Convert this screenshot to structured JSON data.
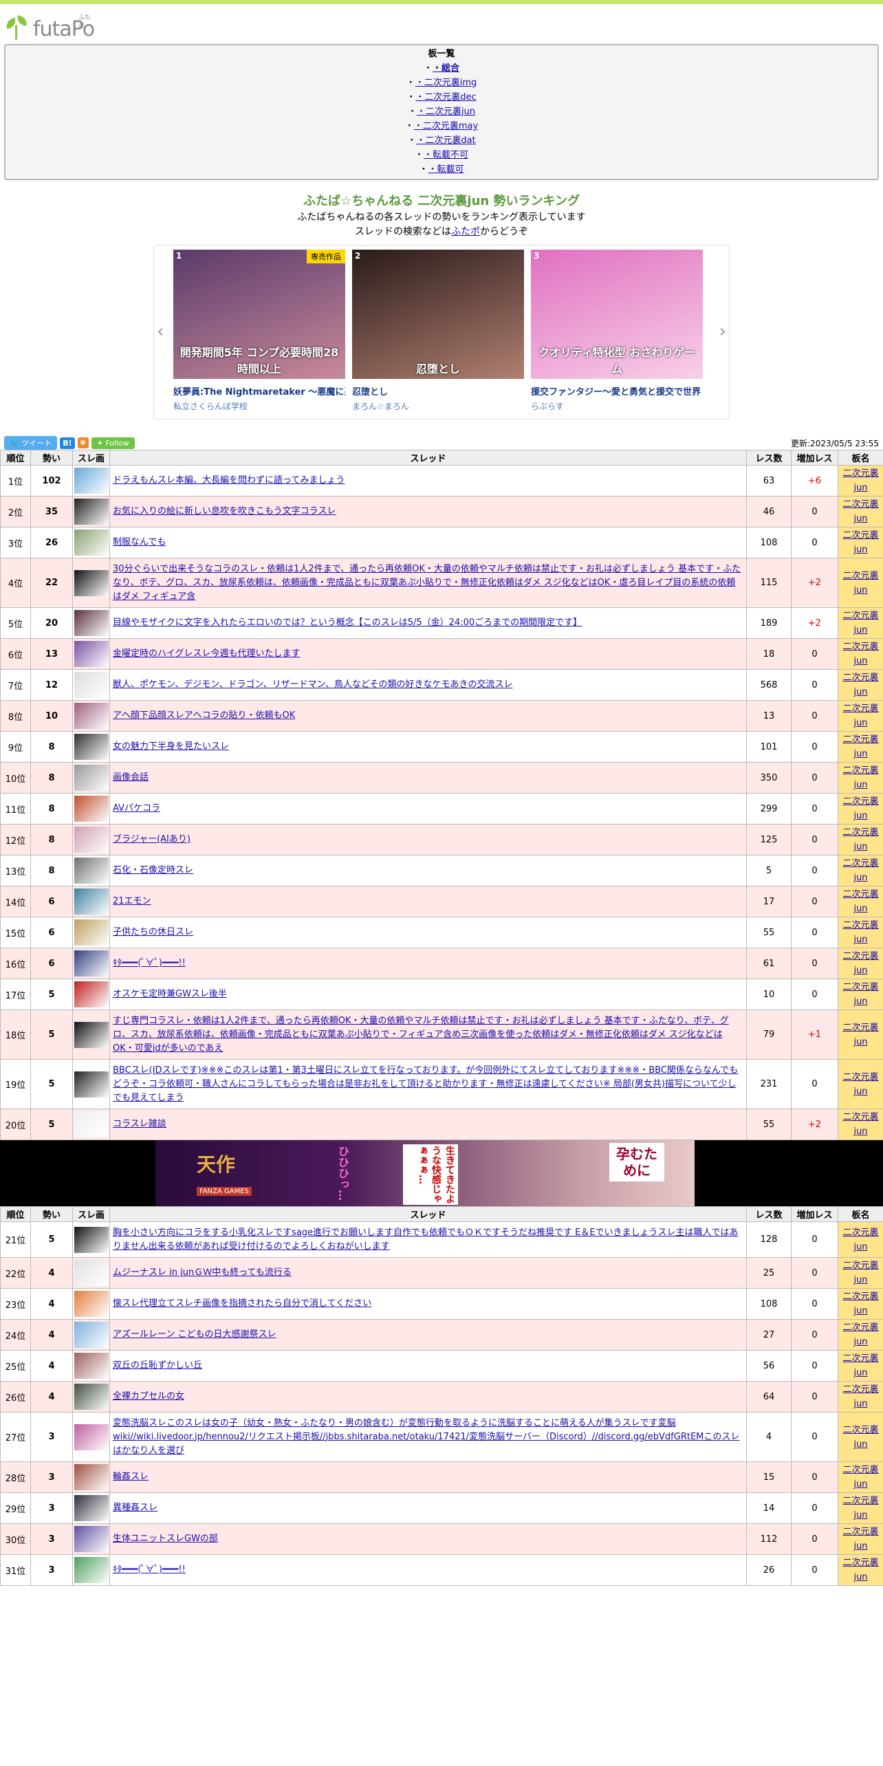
{
  "header": {
    "logo_text": "futaPo",
    "logo_ruby": "ふたポ"
  },
  "board_list": {
    "title": "板一覧",
    "items": [
      "・総合",
      "・二次元裏img",
      "・二次元裏dec",
      "・二次元裏jun",
      "・二次元裏may",
      "・二次元裏dat",
      "・転載不可",
      "・転載可"
    ]
  },
  "headline": {
    "title": "ふたば☆ちゃんねる 二次元裏jun 勢いランキング",
    "desc1": "ふたばちゃんねるの各スレッドの勢いをランキング表示しています",
    "desc2_pre": "スレッドの検索などは",
    "desc2_link": "ふたポ",
    "desc2_post": "からどうぞ"
  },
  "carousel": [
    {
      "num": "1",
      "tag": "専売作品",
      "caption": "開発期間5年 コンプ必要時間28時間以上",
      "name": "妖夢員:The Nightmaretaker ～悪魔に憑か",
      "maker": "私立さくらんぼ学校",
      "colors": [
        "#5a3a6a",
        "#c88a9a"
      ]
    },
    {
      "num": "2",
      "tag": "",
      "caption": "忍堕とし",
      "name": "忍堕とし",
      "maker": "まろん☆まろん",
      "colors": [
        "#2a1a1a",
        "#b08070"
      ]
    },
    {
      "num": "3",
      "tag": "",
      "caption": "クオリティ特化型 おさわりゲーム",
      "name": "援交ファンタジー～愛と勇気と援交で世界",
      "maker": "らぶらす",
      "colors": [
        "#e070c0",
        "#f8d0e8"
      ]
    }
  ],
  "toolbar": {
    "tweet": "ツイート",
    "hatena": "B!",
    "rss": "RSS",
    "follow": "Follow",
    "updated": "更新:2023/05/5 23:55"
  },
  "table_headers": {
    "rank": "順位",
    "momentum": "勢い",
    "thumb": "スレ画",
    "thread": "スレッド",
    "res": "レス数",
    "inc": "増加レス",
    "board": "板名"
  },
  "board_name": "二次元裏jun",
  "threads_1": [
    {
      "rank": "1位",
      "hot": "102",
      "title": "ドラえもんスレ本編、大長編を問わずに語ってみましょう",
      "res": "63",
      "inc": "+6",
      "thumb": "#6aa8d8"
    },
    {
      "rank": "2位",
      "hot": "35",
      "title": "お気に入りの絵に新しい息吹を吹きこもう文字コラスレ",
      "res": "46",
      "inc": "0",
      "thumb": "#222222"
    },
    {
      "rank": "3位",
      "hot": "26",
      "title": "制服なんでも",
      "res": "108",
      "inc": "0",
      "thumb": "#8aa070"
    },
    {
      "rank": "4位",
      "hot": "22",
      "title": "30分ぐらいで出来そうなコラのスレ・依頼は1人2件まで、通ったら再依頼OK・大量の依頼やマルチ依頼は禁止です・お礼は必ずしましょう 基本です・ふたなり、ボテ、グロ、スカ、放尿系依頼は、依頼画像・完成品ともに双葉あぷ小貼りで・無修正化依頼はダメ スジ化などはOK・虐ろ目レイプ目の系統の依頼はダメ フィギュア含",
      "res": "115",
      "inc": "+2",
      "thumb": "#111111"
    },
    {
      "rank": "5位",
      "hot": "20",
      "title": "目線やモザイクに文字を入れたらエロいのでは？という概念【このスレは5/5（金）24:00ごろまでの期間限定です】",
      "res": "189",
      "inc": "+2",
      "thumb": "#5a3040"
    },
    {
      "rank": "6位",
      "hot": "13",
      "title": "金曜定時のハイグレスレ今週も代理いたします",
      "res": "18",
      "inc": "0",
      "thumb": "#7a50a0"
    },
    {
      "rank": "7位",
      "hot": "12",
      "title": "獣人、ポケモン、デジモン、ドラゴン、リザードマン、鳥人などその類の好きなケモあきの交流スレ",
      "res": "568",
      "inc": "0",
      "thumb": "#dddddd"
    },
    {
      "rank": "8位",
      "hot": "10",
      "title": "アヘ顔下品顔スレアヘコラの貼り・依頼もOK",
      "res": "13",
      "inc": "0",
      "thumb": "#a06080"
    },
    {
      "rank": "9位",
      "hot": "8",
      "title": "女の魅力下半身を見たいスレ",
      "res": "101",
      "inc": "0",
      "thumb": "#303030"
    },
    {
      "rank": "10位",
      "hot": "8",
      "title": "画像会話",
      "res": "350",
      "inc": "0",
      "thumb": "#999999"
    },
    {
      "rank": "11位",
      "hot": "8",
      "title": "AVパケコラ",
      "res": "299",
      "inc": "0",
      "thumb": "#c05030"
    },
    {
      "rank": "12位",
      "hot": "8",
      "title": "ブラジャー(AIあり)",
      "res": "125",
      "inc": "0",
      "thumb": "#d0a0b0"
    },
    {
      "rank": "13位",
      "hot": "8",
      "title": "石化・石像定時スレ",
      "res": "5",
      "inc": "0",
      "thumb": "#707070"
    },
    {
      "rank": "14位",
      "hot": "6",
      "title": "21エモン",
      "res": "17",
      "inc": "0",
      "thumb": "#4080a0"
    },
    {
      "rank": "15位",
      "hot": "6",
      "title": "子供たちの休日スレ",
      "res": "55",
      "inc": "0",
      "thumb": "#c0a060"
    },
    {
      "rank": "16位",
      "hot": "6",
      "title": "ｷﾀ━━━(ﾟ∀ﾟ)━━━!!",
      "res": "61",
      "inc": "0",
      "thumb": "#304080"
    },
    {
      "rank": "17位",
      "hot": "5",
      "title": "オスケモ定時兼GWスレ後半",
      "res": "10",
      "inc": "0",
      "thumb": "#c02020"
    },
    {
      "rank": "18位",
      "hot": "5",
      "title": "すじ専門コラスレ・依頼は1人2件まで、通ったら再依頼OK・大量の依頼やマルチ依頼は禁止です・お礼は必ずしましょう 基本です・ふたなり、ボテ、グロ、スカ、放尿系依頼は、依頼画像・完成品ともに双葉あぷ小貼りで・フィギュア含め三次画像を使った依頼はダメ・無修正化依頼はダメ スジ化などはOK・可愛idが多いのであえ",
      "res": "79",
      "inc": "+1",
      "thumb": "#111111"
    },
    {
      "rank": "19位",
      "hot": "5",
      "title": "BBCスレ(IDスレです)※※※このスレは第1・第3土曜日にスレ立てを行なっております。が今回例外にてスレ立てしております※※※・BBC関係ならなんでもどうぞ・コラ依頼可・職人さんにコラしてもらった場合は是非お礼をして頂けると助かります・無修正は遠慮してください※ 局部(男女共)描写について少しでも見えてしまう",
      "res": "231",
      "inc": "0",
      "thumb": "#222222"
    },
    {
      "rank": "20位",
      "hot": "5",
      "title": "コラスレ雑談",
      "res": "55",
      "inc": "+2",
      "thumb": "#eeeeee"
    }
  ],
  "banner": {
    "brand": "天作",
    "brand_sub": "FANZA GAMES",
    "text_a": "ひひひっ…",
    "text_b": "生きてきたような快感じゃぁぁぁ…",
    "text_c": "孕むために"
  },
  "threads_2": [
    {
      "rank": "21位",
      "hot": "5",
      "title": "胸を小さい方向にコラをする小乳化スレですsage進行でお願いします自作でも依頼でもＯＫですそうだね推奨です E＆Eでいきましょうスレ主は職人ではありません出来る依頼があれば受け付けるのでよろしくおねがいします",
      "res": "128",
      "inc": "0",
      "thumb": "#111111"
    },
    {
      "rank": "22位",
      "hot": "4",
      "title": "ムジーナスレ in junＧＷ中も終っても流行る",
      "res": "25",
      "inc": "0",
      "thumb": "#e0e0e0"
    },
    {
      "rank": "23位",
      "hot": "4",
      "title": "懐スレ代理立てスレチ画像を指摘されたら自分で消してください",
      "res": "108",
      "inc": "0",
      "thumb": "#e08040"
    },
    {
      "rank": "24位",
      "hot": "4",
      "title": "アズールレーン こどもの日大感謝祭スレ",
      "res": "27",
      "inc": "0",
      "thumb": "#80b0e0"
    },
    {
      "rank": "25位",
      "hot": "4",
      "title": "双丘の丘恥ずかしい丘",
      "res": "56",
      "inc": "0",
      "thumb": "#a06060"
    },
    {
      "rank": "26位",
      "hot": "4",
      "title": "全裸カプセルの女",
      "res": "64",
      "inc": "0",
      "thumb": "#405040"
    },
    {
      "rank": "27位",
      "hot": "3",
      "title": "変態洗脳スレこのスレは女の子（幼女・熟女・ふたなり・男の娘含む）が変態行動を取るように洗脳することに萌える人が集うスレです変脳wiki//wiki.livedoor.jp/hennou2/リクエスト掲示板//jbbs.shitaraba.net/otaku/17421/変態洗脳サーバー（Discord）//discord.gg/ebVdfGRtEMこのスレはかなり人を選び",
      "res": "4",
      "inc": "0",
      "thumb": "#c060a0"
    },
    {
      "rank": "28位",
      "hot": "3",
      "title": "輪姦スレ",
      "res": "15",
      "inc": "0",
      "thumb": "#a05040"
    },
    {
      "rank": "29位",
      "hot": "3",
      "title": "異種姦スレ",
      "res": "14",
      "inc": "0",
      "thumb": "#303040"
    },
    {
      "rank": "30位",
      "hot": "3",
      "title": "生体ユニットスレGWの部",
      "res": "112",
      "inc": "0",
      "thumb": "#6050a0"
    },
    {
      "rank": "31位",
      "hot": "3",
      "title": "ｷﾀ━━━(ﾟ∀ﾟ)━━━!!",
      "res": "26",
      "inc": "0",
      "thumb": "#50a060"
    }
  ]
}
